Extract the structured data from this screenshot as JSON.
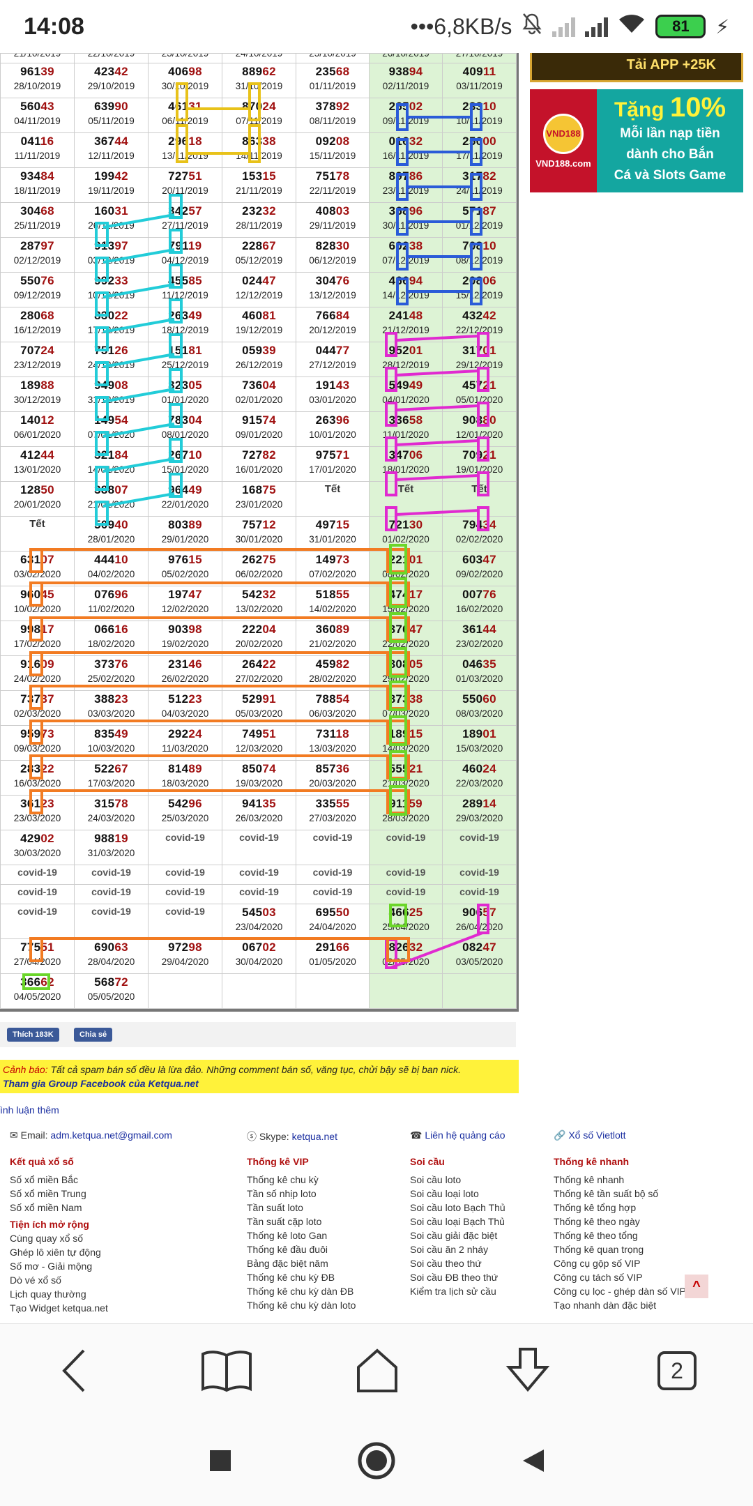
{
  "status_bar": {
    "time": "14:08",
    "network_speed": "•••6,8KB/s",
    "battery": "81",
    "charging_icon": "⚡"
  },
  "table": {
    "partial_top_row": [
      "21/10/2019",
      "22/10/2019",
      "23/10/2019",
      "24/10/2019",
      "25/10/2019",
      "26/10/2019",
      "27/10/2019"
    ],
    "rows": [
      [
        {
          "p": "961",
          "h": "39",
          "d": "28/10/2019"
        },
        {
          "p": "423",
          "h": "42",
          "d": "29/10/2019"
        },
        {
          "p": "406",
          "h": "98",
          "d": "30/10/2019"
        },
        {
          "p": "889",
          "h": "62",
          "d": "31/10/2019"
        },
        {
          "p": "235",
          "h": "68",
          "d": "01/11/2019"
        },
        {
          "p": "938",
          "h": "94",
          "d": "02/11/2019"
        },
        {
          "p": "409",
          "h": "11",
          "d": "03/11/2019"
        }
      ],
      [
        {
          "p": "560",
          "h": "43",
          "d": "04/11/2019"
        },
        {
          "p": "639",
          "h": "90",
          "d": "05/11/2019"
        },
        {
          "p": "461",
          "h": "31",
          "d": "06/11/2019"
        },
        {
          "p": "870",
          "h": "24",
          "d": "07/11/2019"
        },
        {
          "p": "378",
          "h": "92",
          "d": "08/11/2019"
        },
        {
          "p": "265",
          "h": "02",
          "d": "09/11/2019"
        },
        {
          "p": "233",
          "h": "10",
          "d": "10/11/2019"
        }
      ],
      [
        {
          "p": "041",
          "h": "16",
          "d": "11/11/2019"
        },
        {
          "p": "367",
          "h": "44",
          "d": "12/11/2019"
        },
        {
          "p": "296",
          "h": "18",
          "d": "13/11/2019"
        },
        {
          "p": "863",
          "h": "38",
          "d": "14/11/2019"
        },
        {
          "p": "092",
          "h": "08",
          "d": "15/11/2019"
        },
        {
          "p": "016",
          "h": "32",
          "d": "16/11/2019"
        },
        {
          "p": "250",
          "h": "00",
          "d": "17/11/2019"
        }
      ],
      [
        {
          "p": "934",
          "h": "84",
          "d": "18/11/2019"
        },
        {
          "p": "199",
          "h": "42",
          "d": "19/11/2019"
        },
        {
          "p": "727",
          "h": "51",
          "d": "20/11/2019"
        },
        {
          "p": "153",
          "h": "15",
          "d": "21/11/2019"
        },
        {
          "p": "751",
          "h": "78",
          "d": "22/11/2019"
        },
        {
          "p": "897",
          "h": "86",
          "d": "23/11/2019"
        },
        {
          "p": "317",
          "h": "82",
          "d": "24/11/2019"
        }
      ],
      [
        {
          "p": "304",
          "h": "68",
          "d": "25/11/2019"
        },
        {
          "p": "160",
          "h": "31",
          "d": "26/11/2019"
        },
        {
          "p": "342",
          "h": "57",
          "d": "27/11/2019"
        },
        {
          "p": "232",
          "h": "32",
          "d": "28/11/2019"
        },
        {
          "p": "408",
          "h": "03",
          "d": "29/11/2019"
        },
        {
          "p": "368",
          "h": "96",
          "d": "30/11/2019"
        },
        {
          "p": "571",
          "h": "87",
          "d": "01/12/2019"
        }
      ],
      [
        {
          "p": "287",
          "h": "97",
          "d": "02/12/2019"
        },
        {
          "p": "913",
          "h": "97",
          "d": "03/12/2019"
        },
        {
          "p": "791",
          "h": "19",
          "d": "04/12/2019"
        },
        {
          "p": "228",
          "h": "67",
          "d": "05/12/2019"
        },
        {
          "p": "828",
          "h": "30",
          "d": "06/12/2019"
        },
        {
          "p": "602",
          "h": "38",
          "d": "07/12/2019"
        },
        {
          "p": "708",
          "h": "10",
          "d": "08/12/2019"
        }
      ],
      [
        {
          "p": "550",
          "h": "76",
          "d": "09/12/2019"
        },
        {
          "p": "992",
          "h": "33",
          "d": "10/12/2019"
        },
        {
          "p": "455",
          "h": "85",
          "d": "11/12/2019"
        },
        {
          "p": "024",
          "h": "47",
          "d": "12/12/2019"
        },
        {
          "p": "304",
          "h": "76",
          "d": "13/12/2019"
        },
        {
          "p": "466",
          "h": "94",
          "d": "14/12/2019"
        },
        {
          "p": "208",
          "h": "06",
          "d": "15/12/2019"
        }
      ],
      [
        {
          "p": "280",
          "h": "68",
          "d": "16/12/2019"
        },
        {
          "p": "830",
          "h": "22",
          "d": "17/12/2019"
        },
        {
          "p": "263",
          "h": "49",
          "d": "18/12/2019"
        },
        {
          "p": "460",
          "h": "81",
          "d": "19/12/2019"
        },
        {
          "p": "766",
          "h": "84",
          "d": "20/12/2019"
        },
        {
          "p": "241",
          "h": "48",
          "d": "21/12/2019"
        },
        {
          "p": "432",
          "h": "42",
          "d": "22/12/2019"
        }
      ],
      [
        {
          "p": "707",
          "h": "24",
          "d": "23/12/2019"
        },
        {
          "p": "751",
          "h": "26",
          "d": "24/12/2019"
        },
        {
          "p": "151",
          "h": "81",
          "d": "25/12/2019"
        },
        {
          "p": "059",
          "h": "39",
          "d": "26/12/2019"
        },
        {
          "p": "044",
          "h": "77",
          "d": "27/12/2019"
        },
        {
          "p": "952",
          "h": "01",
          "d": "28/12/2019"
        },
        {
          "p": "317",
          "h": "01",
          "d": "29/12/2019"
        }
      ],
      [
        {
          "p": "189",
          "h": "88",
          "d": "30/12/2019"
        },
        {
          "p": "949",
          "h": "08",
          "d": "31/12/2019"
        },
        {
          "p": "323",
          "h": "05",
          "d": "01/01/2020"
        },
        {
          "p": "736",
          "h": "04",
          "d": "02/01/2020"
        },
        {
          "p": "191",
          "h": "43",
          "d": "03/01/2020"
        },
        {
          "p": "549",
          "h": "49",
          "d": "04/01/2020"
        },
        {
          "p": "457",
          "h": "21",
          "d": "05/01/2020"
        }
      ],
      [
        {
          "p": "140",
          "h": "12",
          "d": "06/01/2020"
        },
        {
          "p": "149",
          "h": "54",
          "d": "07/01/2020"
        },
        {
          "p": "783",
          "h": "04",
          "d": "08/01/2020"
        },
        {
          "p": "915",
          "h": "74",
          "d": "09/01/2020"
        },
        {
          "p": "263",
          "h": "96",
          "d": "10/01/2020"
        },
        {
          "p": "336",
          "h": "58",
          "d": "11/01/2020"
        },
        {
          "p": "908",
          "h": "80",
          "d": "12/01/2020"
        }
      ],
      [
        {
          "p": "412",
          "h": "44",
          "d": "13/01/2020"
        },
        {
          "p": "321",
          "h": "84",
          "d": "14/01/2020"
        },
        {
          "p": "267",
          "h": "10",
          "d": "15/01/2020"
        },
        {
          "p": "727",
          "h": "82",
          "d": "16/01/2020"
        },
        {
          "p": "975",
          "h": "71",
          "d": "17/01/2020"
        },
        {
          "p": "347",
          "h": "06",
          "d": "18/01/2020"
        },
        {
          "p": "709",
          "h": "21",
          "d": "19/01/2020"
        }
      ],
      [
        {
          "p": "128",
          "h": "50",
          "d": "20/01/2020"
        },
        {
          "p": "388",
          "h": "07",
          "d": "21/01/2020"
        },
        {
          "p": "964",
          "h": "49",
          "d": "22/01/2020"
        },
        {
          "p": "168",
          "h": "75",
          "d": "23/01/2020"
        },
        {
          "tet": "Tết"
        },
        {
          "tet": "Tết"
        },
        {
          "tet": "Tết"
        }
      ],
      [
        {
          "tet": "Tết"
        },
        {
          "p": "509",
          "h": "40",
          "d": "28/01/2020"
        },
        {
          "p": "803",
          "h": "89",
          "d": "29/01/2020"
        },
        {
          "p": "757",
          "h": "12",
          "d": "30/01/2020"
        },
        {
          "p": "497",
          "h": "15",
          "d": "31/01/2020"
        },
        {
          "p": "721",
          "h": "30",
          "d": "01/02/2020"
        },
        {
          "p": "794",
          "h": "34",
          "d": "02/02/2020"
        }
      ],
      [
        {
          "p": "631",
          "h": "07",
          "d": "03/02/2020"
        },
        {
          "p": "444",
          "h": "10",
          "d": "04/02/2020"
        },
        {
          "p": "976",
          "h": "15",
          "d": "05/02/2020"
        },
        {
          "p": "262",
          "h": "75",
          "d": "06/02/2020"
        },
        {
          "p": "149",
          "h": "73",
          "d": "07/02/2020"
        },
        {
          "p": "221",
          "h": "01",
          "d": "08/02/2020"
        },
        {
          "p": "603",
          "h": "47",
          "d": "09/02/2020"
        }
      ],
      [
        {
          "p": "960",
          "h": "45",
          "d": "10/02/2020"
        },
        {
          "p": "076",
          "h": "96",
          "d": "11/02/2020"
        },
        {
          "p": "197",
          "h": "47",
          "d": "12/02/2020"
        },
        {
          "p": "542",
          "h": "32",
          "d": "13/02/2020"
        },
        {
          "p": "518",
          "h": "55",
          "d": "14/02/2020"
        },
        {
          "p": "474",
          "h": "17",
          "d": "15/02/2020"
        },
        {
          "p": "007",
          "h": "76",
          "d": "16/02/2020"
        }
      ],
      [
        {
          "p": "998",
          "h": "17",
          "d": "17/02/2020"
        },
        {
          "p": "066",
          "h": "16",
          "d": "18/02/2020"
        },
        {
          "p": "903",
          "h": "98",
          "d": "19/02/2020"
        },
        {
          "p": "222",
          "h": "04",
          "d": "20/02/2020"
        },
        {
          "p": "360",
          "h": "89",
          "d": "21/02/2020"
        },
        {
          "p": "376",
          "h": "47",
          "d": "22/02/2020"
        },
        {
          "p": "361",
          "h": "44",
          "d": "23/02/2020"
        }
      ],
      [
        {
          "p": "916",
          "h": "09",
          "d": "24/02/2020"
        },
        {
          "p": "373",
          "h": "76",
          "d": "25/02/2020"
        },
        {
          "p": "231",
          "h": "46",
          "d": "26/02/2020"
        },
        {
          "p": "264",
          "h": "22",
          "d": "27/02/2020"
        },
        {
          "p": "459",
          "h": "82",
          "d": "28/02/2020"
        },
        {
          "p": "808",
          "h": "05",
          "d": "29/02/2020"
        },
        {
          "p": "046",
          "h": "35",
          "d": "01/03/2020"
        }
      ],
      [
        {
          "p": "737",
          "h": "37",
          "d": "02/03/2020"
        },
        {
          "p": "388",
          "h": "23",
          "d": "03/03/2020"
        },
        {
          "p": "512",
          "h": "23",
          "d": "04/03/2020"
        },
        {
          "p": "529",
          "h": "91",
          "d": "05/03/2020"
        },
        {
          "p": "788",
          "h": "54",
          "d": "06/03/2020"
        },
        {
          "p": "873",
          "h": "38",
          "d": "07/03/2020"
        },
        {
          "p": "550",
          "h": "60",
          "d": "08/03/2020"
        }
      ],
      [
        {
          "p": "959",
          "h": "73",
          "d": "09/03/2020"
        },
        {
          "p": "835",
          "h": "49",
          "d": "10/03/2020"
        },
        {
          "p": "292",
          "h": "24",
          "d": "11/03/2020"
        },
        {
          "p": "749",
          "h": "51",
          "d": "12/03/2020"
        },
        {
          "p": "731",
          "h": "18",
          "d": "13/03/2020"
        },
        {
          "p": "189",
          "h": "15",
          "d": "14/03/2020"
        },
        {
          "p": "189",
          "h": "01",
          "d": "15/03/2020"
        }
      ],
      [
        {
          "p": "283",
          "h": "22",
          "d": "16/03/2020"
        },
        {
          "p": "522",
          "h": "67",
          "d": "17/03/2020"
        },
        {
          "p": "814",
          "h": "89",
          "d": "18/03/2020"
        },
        {
          "p": "850",
          "h": "74",
          "d": "19/03/2020"
        },
        {
          "p": "857",
          "h": "36",
          "d": "20/03/2020"
        },
        {
          "p": "555",
          "h": "21",
          "d": "21/03/2020"
        },
        {
          "p": "460",
          "h": "24",
          "d": "22/03/2020"
        }
      ],
      [
        {
          "p": "361",
          "h": "23",
          "d": "23/03/2020"
        },
        {
          "p": "315",
          "h": "78",
          "d": "24/03/2020"
        },
        {
          "p": "542",
          "h": "96",
          "d": "25/03/2020"
        },
        {
          "p": "941",
          "h": "35",
          "d": "26/03/2020"
        },
        {
          "p": "335",
          "h": "55",
          "d": "27/03/2020"
        },
        {
          "p": "911",
          "h": "59",
          "d": "28/03/2020"
        },
        {
          "p": "289",
          "h": "14",
          "d": "29/03/2020"
        }
      ],
      [
        {
          "p": "429",
          "h": "02",
          "d": "30/03/2020"
        },
        {
          "p": "988",
          "h": "19",
          "d": "31/03/2020"
        },
        {
          "cov": "covid-19"
        },
        {
          "cov": "covid-19"
        },
        {
          "cov": "covid-19"
        },
        {
          "cov": "covid-19"
        },
        {
          "cov": "covid-19"
        }
      ],
      [
        {
          "cov": "covid-19"
        },
        {
          "cov": "covid-19"
        },
        {
          "cov": "covid-19"
        },
        {
          "cov": "covid-19"
        },
        {
          "cov": "covid-19"
        },
        {
          "cov": "covid-19"
        },
        {
          "cov": "covid-19"
        }
      ],
      [
        {
          "cov": "covid-19"
        },
        {
          "cov": "covid-19"
        },
        {
          "cov": "covid-19"
        },
        {
          "cov": "covid-19"
        },
        {
          "cov": "covid-19"
        },
        {
          "cov": "covid-19"
        },
        {
          "cov": "covid-19"
        }
      ],
      [
        {
          "cov": "covid-19"
        },
        {
          "cov": "covid-19"
        },
        {
          "cov": "covid-19"
        },
        {
          "p": "545",
          "h": "03",
          "d": "23/04/2020"
        },
        {
          "p": "695",
          "h": "50",
          "d": "24/04/2020"
        },
        {
          "p": "466",
          "h": "25",
          "d": "25/04/2020"
        },
        {
          "p": "906",
          "h": "57",
          "d": "26/04/2020"
        }
      ],
      [
        {
          "p": "775",
          "h": "51",
          "d": "27/04/2020"
        },
        {
          "p": "690",
          "h": "63",
          "d": "28/04/2020"
        },
        {
          "p": "972",
          "h": "98",
          "d": "29/04/2020"
        },
        {
          "p": "067",
          "h": "02",
          "d": "30/04/2020"
        },
        {
          "p": "291",
          "h": "66",
          "d": "01/05/2020"
        },
        {
          "p": "826",
          "h": "32",
          "d": "02/05/2020"
        },
        {
          "p": "082",
          "h": "47",
          "d": "03/05/2020"
        }
      ],
      [
        {
          "p": "366",
          "h": "62",
          "d": "04/05/2020"
        },
        {
          "p": "568",
          "h": "72",
          "d": "05/05/2020"
        },
        {},
        {},
        {},
        {},
        {}
      ]
    ]
  },
  "ads": {
    "strip_text": "Tải APP +25K",
    "brand": "VND188",
    "brand_domain": "VND188.com",
    "headline": "Tặng",
    "percent": "10%",
    "line1": "Mỗi lần nạp tiền",
    "line2": "dành cho Bắn",
    "line3": "Cá và Slots Game"
  },
  "share": {
    "like_label": "Thích 183K",
    "share_label": "Chia sẻ"
  },
  "warning": {
    "label": "Cảnh báo:",
    "text": " Tất cả spam bán số đều là lừa đảo. Những comment bán số, văng tục, chửi bậy sẽ bị ban nick.",
    "link": "Tham gia Group Facebook của Ketqua.net"
  },
  "comments_link": "ình luận thêm",
  "footer": {
    "email_label": "Email: ",
    "email": "adm.ketqua.net@gmail.com",
    "skype_label": "Skype: ",
    "skype": "ketqua.net",
    "ads_contact": "Liên hệ quảng cáo",
    "vietlott": "Xổ số Vietlott",
    "col1_head": "Kết quả xổ số",
    "col1_items": [
      "Số xổ miền Bắc",
      "Số xổ miền Trung",
      "Số xổ miền Nam"
    ],
    "col1_head2": "Tiện ích mở rộng",
    "col1_items2": [
      "Cùng quay xổ số",
      "Ghép lô xiên tự động",
      "Số mơ - Giải mộng",
      "Dò vé xổ số",
      "Lịch quay thường",
      "Tạo Widget ketqua.net"
    ],
    "col2_head": "Thống kê VIP",
    "col2_items": [
      "Thống kê chu kỳ",
      "Tần số nhịp loto",
      "Tần suất loto",
      "Tần suất cặp loto",
      "Thống kê loto Gan",
      "Thống kê đầu đuôi",
      "Bảng đặc biệt năm",
      "Thống kê chu kỳ ĐB",
      "Thống kê chu kỳ dàn ĐB",
      "Thống kê chu kỳ dàn loto"
    ],
    "col3_head": "Soi cầu",
    "col3_items": [
      "Soi cầu loto",
      "Soi cầu loại loto",
      "Soi cầu loto Bạch Thủ",
      "Soi cầu loại Bạch Thủ",
      "Soi cầu giải đặc biệt",
      "Soi cầu ăn 2 nháy",
      "Soi cầu theo thứ",
      "Soi cầu ĐB theo thứ",
      "Kiểm tra lịch sử cầu"
    ],
    "col4_head": "Thống kê nhanh",
    "col4_items": [
      "Thống kê nhanh",
      "Thống kê tần suất bộ số",
      "Thống kê tổng hợp",
      "Thống kê theo ngày",
      "Thống kê theo tổng",
      "Thống kê quan trọng",
      "Công cụ gộp số VIP",
      "Công cụ tách số VIP",
      "Công cụ lọc - ghép dàn số VIP",
      "Tạo nhanh dàn đặc biệt"
    ]
  },
  "browser_bar": {
    "tab_count": "2"
  },
  "colors": {
    "highlight": "#a01010",
    "green_column": "#ddf3d5",
    "warning": "#fff23a",
    "footer_head": "#b01010"
  }
}
